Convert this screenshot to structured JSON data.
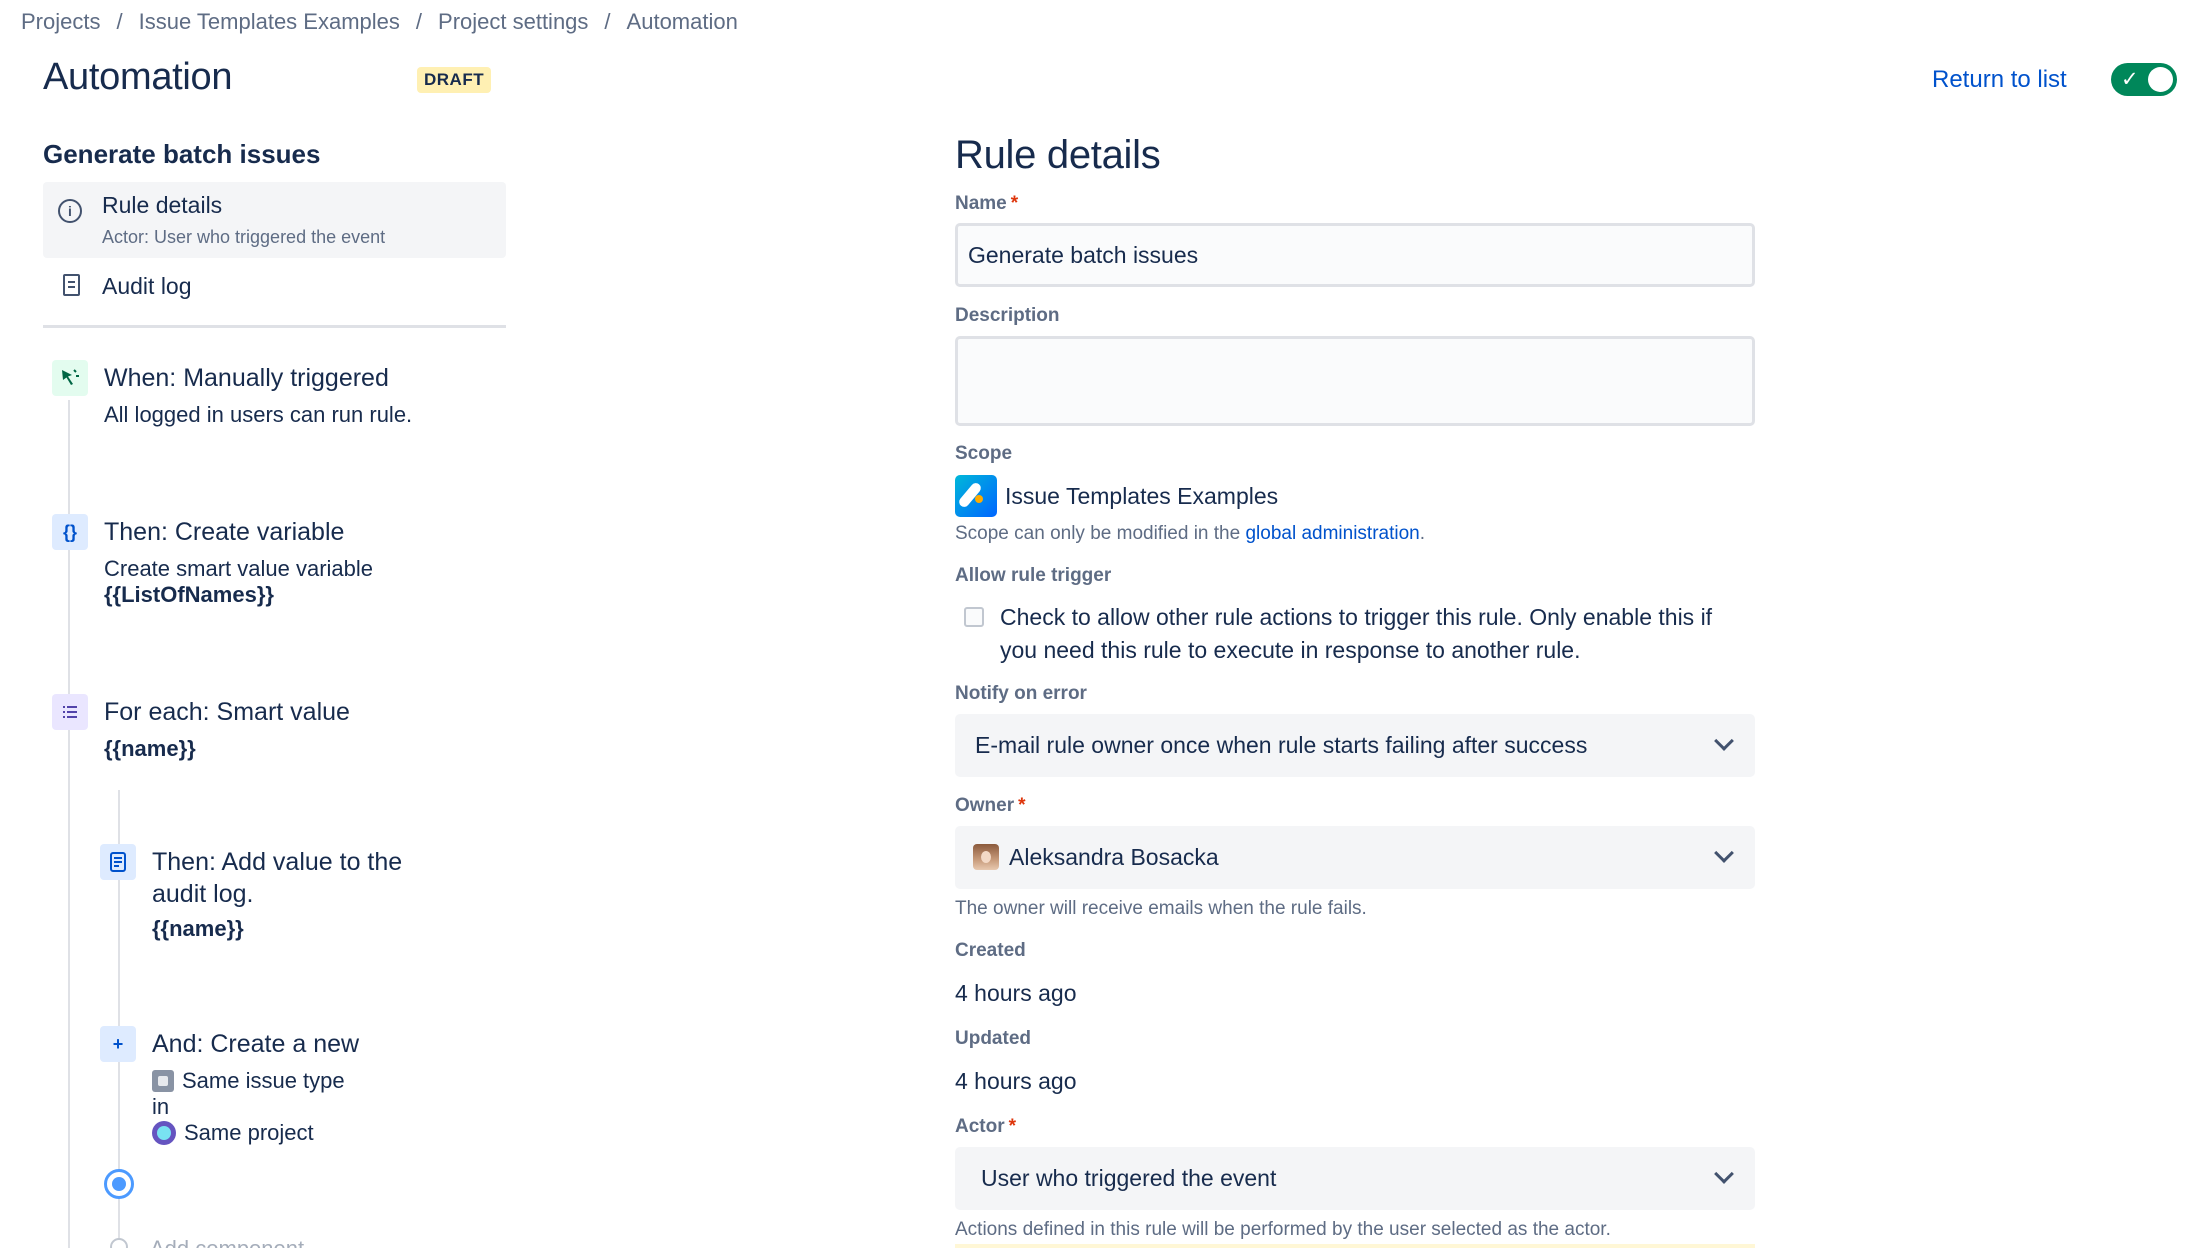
{
  "breadcrumb": {
    "items": [
      "Projects",
      "Issue Templates Examples",
      "Project settings",
      "Automation"
    ],
    "separator": "/"
  },
  "header": {
    "title": "Automation",
    "badge": "DRAFT",
    "return_link": "Return to list",
    "rule_enabled": true,
    "toggle_color": "#00875a"
  },
  "sidebar": {
    "rule_name": "Generate batch issues",
    "nav": {
      "rule_details": {
        "label": "Rule details",
        "sub": "Actor: User who triggered the event",
        "icon": "info-icon"
      },
      "audit_log": {
        "label": "Audit log",
        "icon": "document-icon"
      }
    }
  },
  "steps": {
    "trigger": {
      "title": "When: Manually triggered",
      "line1": "All logged in users can run rule.",
      "icon": "cursor-click-icon"
    },
    "variable": {
      "title": "Then: Create variable",
      "line1": "Create smart value variable",
      "line2": "{{ListOfNames}}",
      "icon": "braces-icon"
    },
    "foreach": {
      "title": "For each: Smart value",
      "line1": "{{name}}",
      "icon": "list-icon"
    },
    "audit": {
      "title_line1": "Then: Add value to the",
      "title_line2": "audit log.",
      "line1": "{{name}}",
      "icon": "document-icon"
    },
    "create": {
      "title": "And: Create a new",
      "issue_type": "Same issue type",
      "connector": "in",
      "project": "Same project",
      "icon": "plus-icon"
    },
    "add_component": "Add component"
  },
  "details": {
    "heading": "Rule details",
    "name": {
      "label": "Name",
      "value": "Generate batch issues"
    },
    "description": {
      "label": "Description",
      "value": ""
    },
    "scope": {
      "label": "Scope",
      "value": "Issue Templates Examples",
      "helper_prefix": "Scope can only be modified in the",
      "helper_link": "global administration",
      "helper_suffix": "."
    },
    "allow_trigger": {
      "label": "Allow rule trigger",
      "checked": false,
      "text": "Check to allow other rule actions to trigger this rule. Only enable this if you need this rule to execute in response to another rule."
    },
    "notify": {
      "label": "Notify on error",
      "value": "E-mail rule owner once when rule starts failing after success"
    },
    "owner": {
      "label": "Owner",
      "value": "Aleksandra Bosacka",
      "helper": "The owner will receive emails when the rule fails."
    },
    "created": {
      "label": "Created",
      "value": "4 hours ago"
    },
    "updated": {
      "label": "Updated",
      "value": "4 hours ago"
    },
    "actor": {
      "label": "Actor",
      "value": "User who triggered the event",
      "helper": "Actions defined in this rule will be performed by the user selected as the actor."
    },
    "required_mark": "*"
  }
}
